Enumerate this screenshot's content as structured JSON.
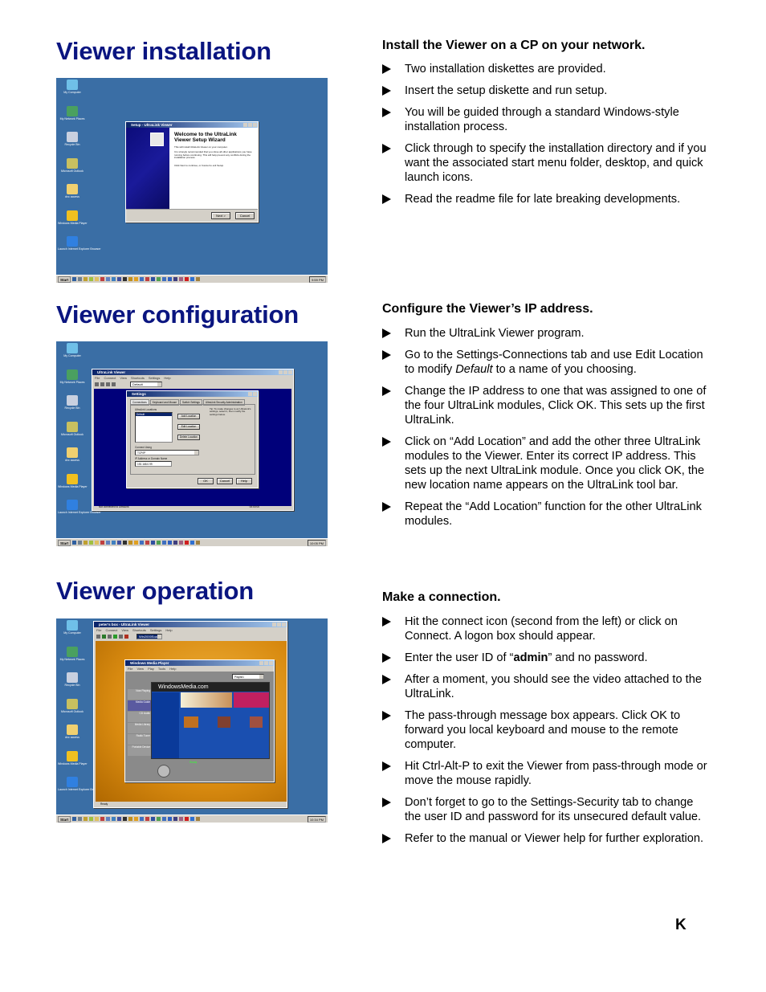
{
  "sections": [
    {
      "title": "Viewer installation",
      "heading": "Install the Viewer on a CP on your network.",
      "bullets": [
        "Two installation diskettes are provided.",
        "Insert the setup diskette and run setup.",
        "You will be guided through a standard Windows-style installation process.",
        "Click through to specify the installation directory and if you want the associated start menu folder, desktop, and quick launch icons.",
        "Read the readme file for late breaking developments."
      ]
    },
    {
      "title": "Viewer configuration",
      "heading": "Configure the Viewer’s IP address.",
      "bullets": [
        "Run the UltraLink Viewer program.",
        {
          "pre": "Go to the Settings-Connections tab and use Edit Location to modify ",
          "em": "Default",
          "post": " to a name of you choosing."
        },
        "Change the IP address to one that was assigned to one of the four UltraLink modules, Click OK.  This sets up the first UltraLink.",
        "Click on “Add Location” and add the other three UltraLink modules to the Viewer.  Enter its correct IP address. This sets up the next UltraLink module. Once you click OK, the new location name appears on the UltraLink tool bar.",
        "Repeat the “Add Location” function for the other UltraLink modules."
      ]
    },
    {
      "title": "Viewer operation",
      "heading": "Make a connection.",
      "bullets": [
        "Hit the connect icon (second from the left) or click on Connect.  A logon box should appear.",
        {
          "pre": "Enter the user ID of “",
          "strong": "admin",
          "post": "” and no password."
        },
        "After a moment, you should see the video attached to the UltraLink.",
        "The pass-through message box appears.  Click OK to forward you local keyboard and mouse to the remote computer.",
        "Hit Ctrl-Alt-P to exit the Viewer from pass-through mode or move the mouse rapidly.",
        "Don’t forget to go to the Settings-Security tab to change the user ID and password for its unsecured default value.",
        "Refer to the manual or Viewer help for further exploration."
      ]
    }
  ],
  "page_key": "K",
  "screenshots": {
    "desktop_icons": [
      "My Computer",
      "My Network Places",
      "Recycle Bin",
      "Microsoft Outlook",
      "dvc access",
      "Windows Media Player",
      "Launch Internet Explorer Browser"
    ],
    "taskbar": {
      "start_label": "Start",
      "clock_1": "9:59 PM",
      "clock_2": "10:05 PM",
      "clock_3": "10:34 PM"
    },
    "setup": {
      "window_title": "Setup - UltraLink Viewer",
      "welcome_heading": "Welcome to the UltraLink Viewer Setup Wizard",
      "line1": "This will install UltraLink Viewer on your computer.",
      "line2": "It is strongly recommended that you close all other applications you have running before continuing. This will help prevent any conflicts during the installation process.",
      "line3": "Click Next to continue, or Cancel to exit Setup.",
      "next_label": "Next >",
      "cancel_label": "Cancel"
    },
    "config": {
      "app_title": "UltraLink Viewer",
      "menus": [
        "File",
        "Connect",
        "View",
        "Shortcuts",
        "Settings",
        "Help"
      ],
      "location_combo": "Default",
      "dialog_title": "Settings",
      "tabs": [
        "Connections",
        "Keyboard and Mouse",
        "Switch Settings",
        "UltraLink Security Administration"
      ],
      "locations_label": "UltraLink Locations",
      "locations": [
        "Default"
      ],
      "add_location": "Add Location",
      "edit_location": "Edit Location",
      "delete_location": "Delete Location",
      "tip": "Tip: To make changes to an UltraLink's settings, select it, then modify the settings below.",
      "connect_using_label": "Connect Using",
      "connect_using": "TCP/IP",
      "ip_label": "IP Address or Domain Name",
      "ip_value": "192.168.0.99",
      "ok": "OK",
      "cancel": "Cancel",
      "help": "Help",
      "status": "Not connected to UltraLink",
      "timer": "00:00:00"
    },
    "operation": {
      "app_title": "peter's box - UltraLink Viewer",
      "menus": [
        "File",
        "Connect",
        "View",
        "Shortcuts",
        "Settings",
        "Help"
      ],
      "location_combo": "Win2000Soap",
      "wmp_title": "Windows Media Player",
      "wmp_menus": [
        "File",
        "View",
        "Play",
        "Tools",
        "Help"
      ],
      "wmp_site": "WindowsMedia.com",
      "wmp_status": "Ready",
      "playlist": "Playlist1",
      "nav": [
        "Now Playing",
        "Media Guide",
        "CD Audio",
        "Media Library",
        "Radio Tuner",
        "Portable Device"
      ],
      "status": "Ready"
    }
  }
}
